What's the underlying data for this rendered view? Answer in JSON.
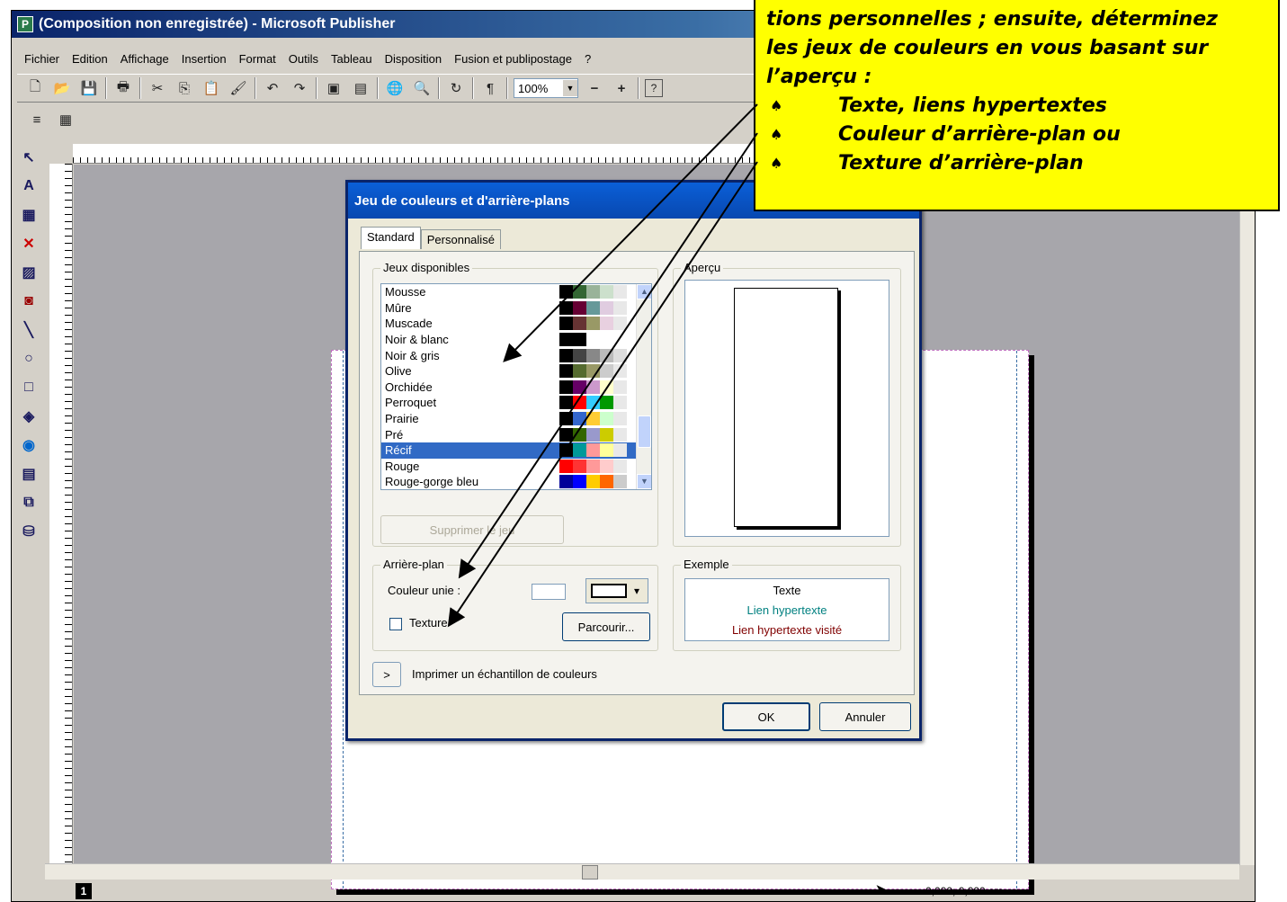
{
  "window": {
    "title": "(Composition non enregistrée) - Microsoft Publisher"
  },
  "menu": [
    "Fichier",
    "Edition",
    "Affichage",
    "Insertion",
    "Format",
    "Outils",
    "Tableau",
    "Disposition",
    "Fusion et publipostage",
    "?"
  ],
  "toolbar": {
    "zoom": "100%",
    "pilcrow": "¶",
    "zoom_out": "−",
    "zoom_in": "+",
    "help": "?"
  },
  "toolbox_icons": [
    "pointer-icon",
    "text-box-icon",
    "table-icon",
    "wordart-icon",
    "picture-icon",
    "clipart-icon",
    "line-icon",
    "oval-icon",
    "rectangle-icon",
    "autoshapes-icon",
    "web-icon",
    "form-icon",
    "objects-icon",
    "design-gallery-icon"
  ],
  "status": {
    "page": "1",
    "coords": "0,000; 0,000 cm"
  },
  "dialog": {
    "title": "Jeu de couleurs et d'arrière-plans",
    "tabs": [
      "Standard",
      "Personnalisé"
    ],
    "available_label": "Jeux disponibles",
    "preview_label": "Aperçu",
    "schemes": [
      {
        "name": "Mousse",
        "colors": [
          "#000000",
          "#336633",
          "#99b399",
          "#cce0cc",
          "#e8e8e8"
        ]
      },
      {
        "name": "Mûre",
        "colors": [
          "#000000",
          "#660033",
          "#669999",
          "#e0cce0",
          "#e8e8e8"
        ]
      },
      {
        "name": "Muscade",
        "colors": [
          "#000000",
          "#663333",
          "#999966",
          "#e8d0e0",
          "#e8e8e8"
        ]
      },
      {
        "name": "Noir & blanc",
        "colors": [
          "#000000",
          "#000000",
          "#ffffff",
          "#ffffff",
          "#ffffff"
        ]
      },
      {
        "name": "Noir & gris",
        "colors": [
          "#000000",
          "#444444",
          "#888888",
          "#bbbbbb",
          "#dddddd"
        ]
      },
      {
        "name": "Olive",
        "colors": [
          "#000000",
          "#556b2f",
          "#999966",
          "#cccccc",
          "#e8e8e8"
        ]
      },
      {
        "name": "Orchidée",
        "colors": [
          "#000000",
          "#660066",
          "#cc99cc",
          "#ffffcc",
          "#e8e8e8"
        ]
      },
      {
        "name": "Perroquet",
        "colors": [
          "#000000",
          "#ff0000",
          "#33ccff",
          "#009900",
          "#e8e8e8"
        ]
      },
      {
        "name": "Prairie",
        "colors": [
          "#000000",
          "#3366cc",
          "#ffcc33",
          "#ccffcc",
          "#e8e8e8"
        ]
      },
      {
        "name": "Pré",
        "colors": [
          "#000000",
          "#336600",
          "#9999cc",
          "#cccc00",
          "#e8e8e8"
        ]
      },
      {
        "name": "Récif",
        "colors": [
          "#000000",
          "#009999",
          "#ff9999",
          "#ffff99",
          "#e8e8e8"
        ]
      },
      {
        "name": "Rouge",
        "colors": [
          "#ff0000",
          "#ff3333",
          "#ff9999",
          "#ffcccc",
          "#e8e8e8"
        ]
      },
      {
        "name": "Rouge-gorge bleu",
        "colors": [
          "#000099",
          "#0000ff",
          "#ffcc00",
          "#ff6600",
          "#cccccc"
        ]
      }
    ],
    "selected_index": 10,
    "delete_button": "Supprimer le jeu",
    "background_label": "Arrière-plan",
    "solid_color_label": "Couleur unie :",
    "texture_label": "Texture",
    "browse_button": "Parcourir...",
    "example_label": "Exemple",
    "example_text": "Texte",
    "example_link": "Lien hypertexte",
    "example_visited": "Lien hypertexte visité",
    "expand_button": ">",
    "print_sample_label": "Imprimer un échantillon de couleurs",
    "ok_button": "OK",
    "cancel_button": "Annuler",
    "link_color": "#008080",
    "visited_color": "#800000"
  },
  "annotation": {
    "lines": [
      "tions personnelles ; ensuite, déterminez",
      "les jeux de couleurs en vous basant sur",
      "l’aperçu :"
    ],
    "bullets": [
      "Texte, liens hypertextes",
      "Couleur d’arrière-plan ou",
      "Texture d’arrière-plan"
    ],
    "bullet_mark": "♠"
  }
}
